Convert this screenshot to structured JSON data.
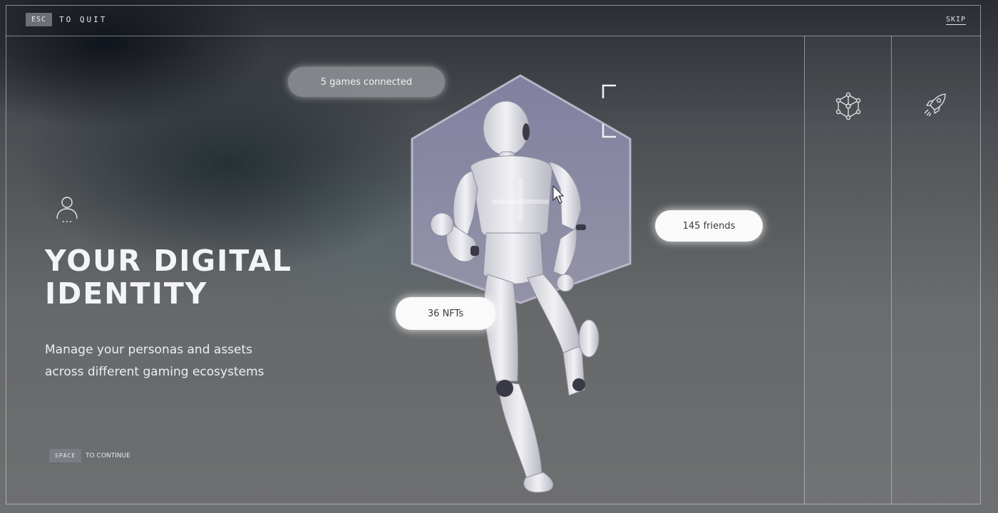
{
  "top_bar": {
    "esc_key": "ESC",
    "esc_hint": "TO QUIT",
    "skip_label": "SKIP"
  },
  "side_panel": {
    "icons": [
      "network-cube-icon",
      "rocket-icon"
    ]
  },
  "hero": {
    "icon": "user-profile-icon",
    "title_line1": "YOUR DIGITAL",
    "title_line2": "IDENTITY",
    "subtitle_line1": "Manage your personas and assets",
    "subtitle_line2": "across different gaming ecosystems"
  },
  "stats": {
    "games": "5 games connected",
    "friends": "145 friends",
    "nfts": "36 NFTs"
  },
  "bottom": {
    "space_key": "SPACE",
    "continue_hint": "TO CONTINUE"
  },
  "colors": {
    "text": "#f3f4f6",
    "frame_lines": "#dce0e6",
    "pill_bright": "#fafafa",
    "hex_fill": "#9a98b8"
  }
}
